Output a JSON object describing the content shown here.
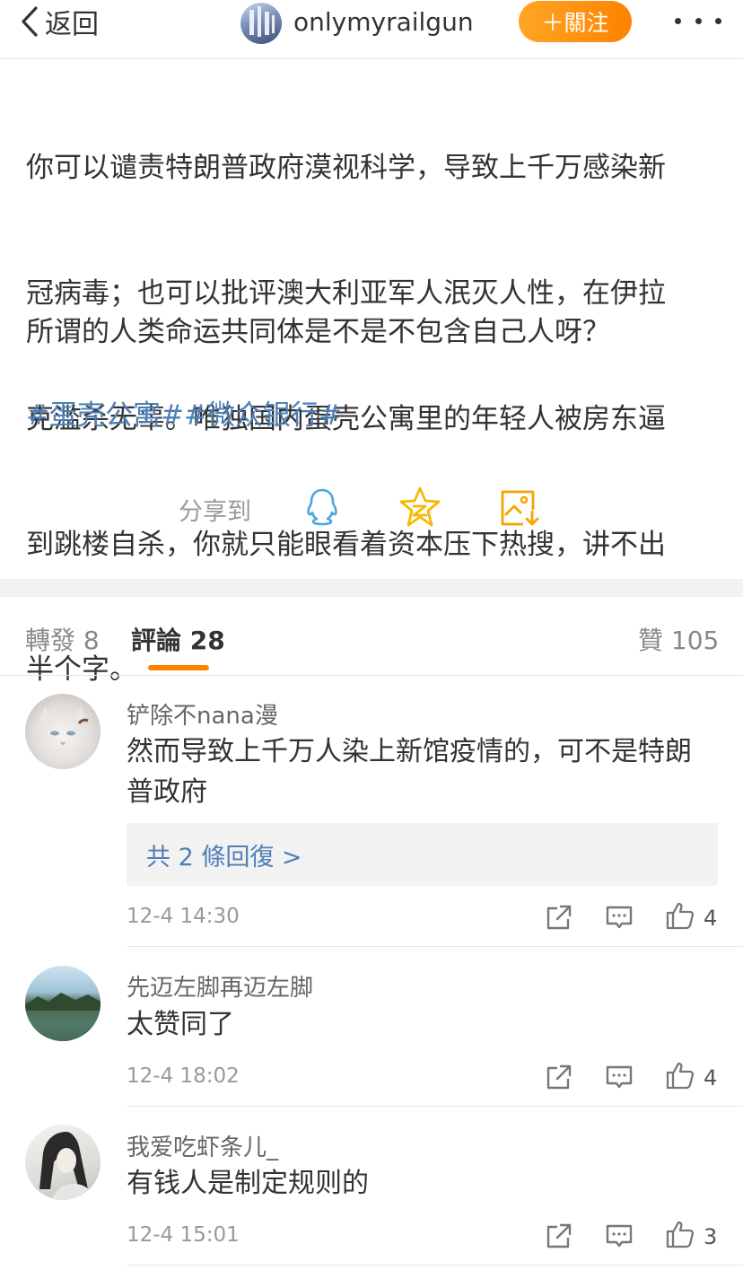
{
  "nav": {
    "back_label": "返回",
    "username": "onlymyrailgun",
    "follow_label": "＋關注"
  },
  "post": {
    "paragraph1": "你可以谴责特朗普政府漠视科学，导致上千万感染新冠病毒；也可以批评澳大利亚军人泯灭人性，在伊拉克滥杀无辜。唯独国内蛋壳公寓里的年轻人被房东逼到跳楼自杀，你就只能眼看着资本压下热搜，讲不出半个字。",
    "paragraph1_lines": [
      "你可以谴责特朗普政府漠视科学，导致上千万感染新",
      "冠病毒；也可以批评澳大利亚军人泯灭人性，在伊拉",
      "克滥杀无辜。唯独国内蛋壳公寓里的年轻人被房东逼",
      "到跳楼自杀，你就只能眼看着资本压下热搜，讲不出",
      "半个字。"
    ],
    "paragraph2": "所谓的人类命运共同体是不是不包含自己人呀？",
    "tags": [
      "#蛋壳公寓#",
      "#微众银行#"
    ]
  },
  "share": {
    "label": "分享到",
    "targets": [
      "qq-icon",
      "qzone-star-icon",
      "save-image-icon"
    ]
  },
  "tabs": {
    "repost_label": "轉發 8",
    "comment_label": "評論 28",
    "like_label": "贊 105",
    "active": "comment"
  },
  "comments": [
    {
      "name": "铲除不nana漫",
      "text_lines": [
        "然而导致上千万人染上新馆疫情的，可不是特朗",
        "普政府"
      ],
      "replies_label": "共 2 條回復 >",
      "time": "12-4 14:30",
      "likes": "4"
    },
    {
      "name": "先迈左脚再迈左脚",
      "text_lines": [
        "太赞同了"
      ],
      "time": "12-4 18:02",
      "likes": "4"
    },
    {
      "name": "我爱吃虾条儿_",
      "text_lines": [
        "有钱人是制定规则的"
      ],
      "time": "12-4 15:01",
      "likes": "3"
    }
  ],
  "colors": {
    "accent": "#ff8200",
    "link": "#4e7fb7",
    "separator": "#f2f2f2"
  }
}
